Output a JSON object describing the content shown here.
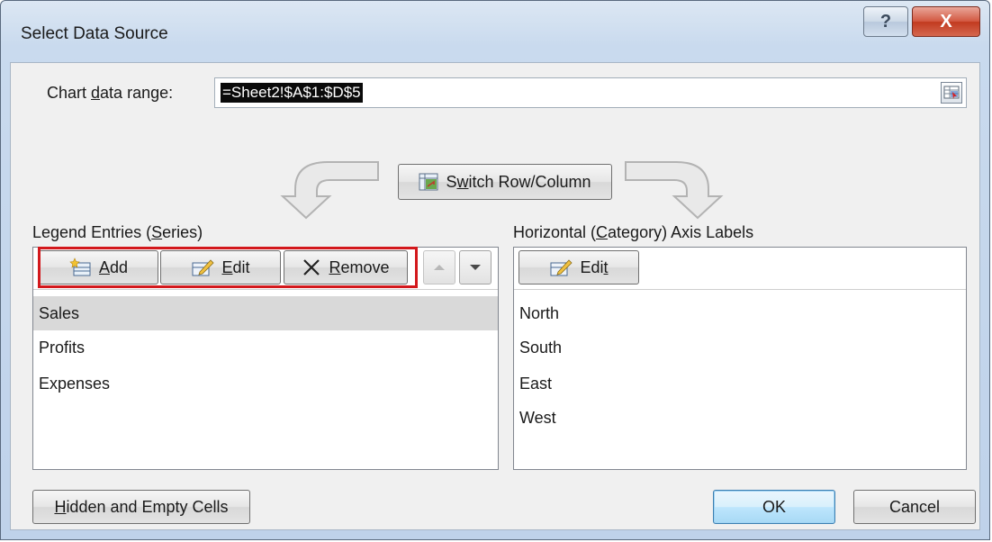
{
  "window": {
    "title": "Select Data Source",
    "help_glyph": "?",
    "close_glyph": "X"
  },
  "range": {
    "label_pre": "Chart ",
    "label_u": "d",
    "label_post": "ata range:",
    "value": "=Sheet2!$A$1:$D$5"
  },
  "switch_button": {
    "pre": "S",
    "u": "w",
    "post": "itch Row/Column"
  },
  "legend": {
    "heading_pre": "Legend Entries (",
    "heading_u": "S",
    "heading_post": "eries)",
    "add": {
      "u": "A",
      "post": "dd"
    },
    "edit": {
      "u": "E",
      "post": "dit"
    },
    "remove": {
      "u": "R",
      "post": "emove"
    },
    "items": [
      "Sales",
      "Profits",
      "Expenses"
    ],
    "selected_index": 0
  },
  "axis": {
    "heading_pre": "Horizontal (",
    "heading_u": "C",
    "heading_post": "ategory) Axis Labels",
    "edit": {
      "pre": "Edi",
      "u": "t"
    },
    "items": [
      "North",
      "South",
      "East",
      "West"
    ]
  },
  "footer": {
    "hidden_u": "H",
    "hidden_post": "idden and Empty Cells",
    "ok": "OK",
    "cancel": "Cancel"
  },
  "colors": {
    "highlight_box": "#d3181c",
    "selected_row": "#d9d9d9"
  }
}
